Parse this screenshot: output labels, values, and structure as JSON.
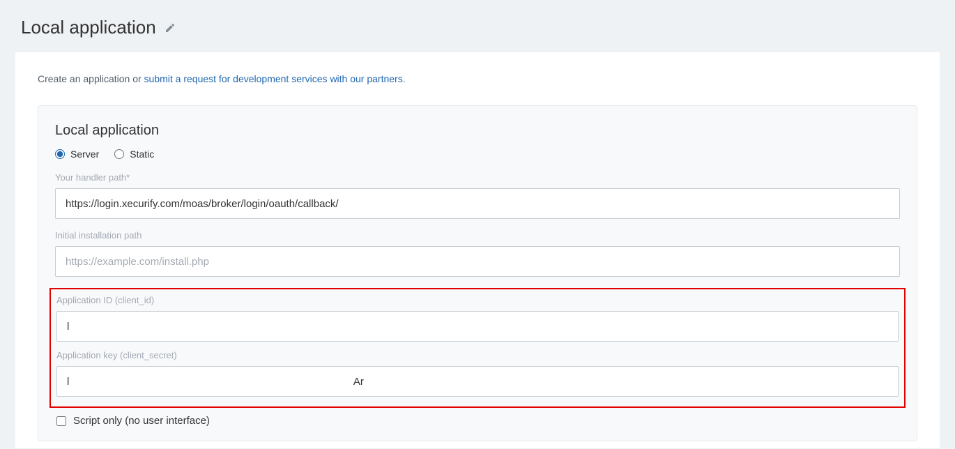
{
  "header": {
    "title": "Local application"
  },
  "intro": {
    "prefix": "Create an application or ",
    "link": "submit a request for development services with our partners."
  },
  "form": {
    "section_title": "Local application",
    "radio": {
      "server_label": "Server",
      "static_label": "Static",
      "selected": "server"
    },
    "handler_path": {
      "label": "Your handler path*",
      "value": "https://login.xecurify.com/moas/broker/login/oauth/callback/"
    },
    "install_path": {
      "label": "Initial installation path",
      "placeholder": "https://example.com/install.php",
      "value": ""
    },
    "client_id": {
      "label": "Application ID (client_id)",
      "value": "l"
    },
    "client_secret": {
      "label": "Application key (client_secret)",
      "value": "l                                                                                                  Ar"
    },
    "script_only": {
      "label": "Script only (no user interface)",
      "checked": false
    }
  }
}
